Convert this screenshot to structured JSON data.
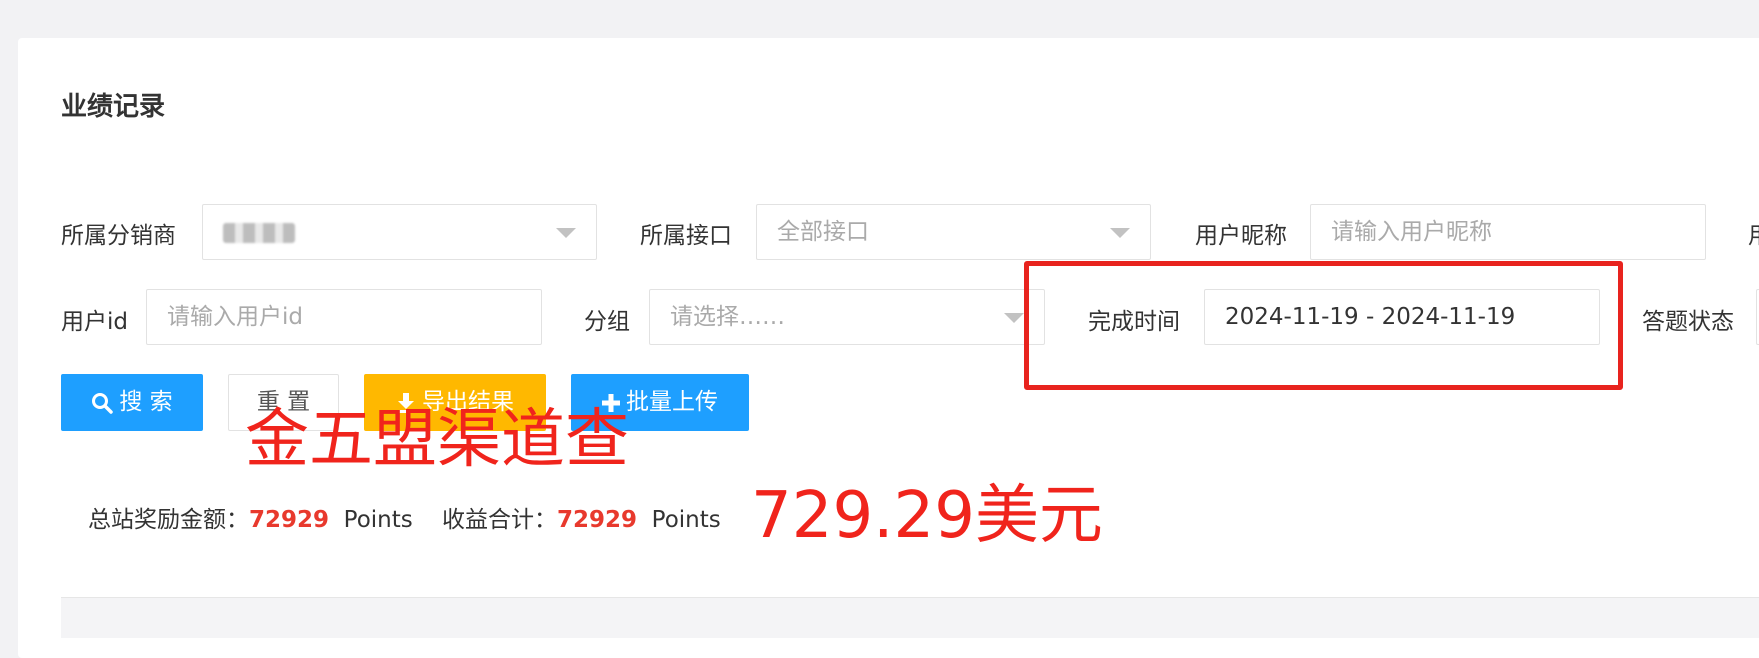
{
  "title": "业绩记录",
  "filters": {
    "distributor_label": "所属分销商",
    "interface_label": "所属接口",
    "interface_placeholder": "全部接口",
    "nickname_label": "用户昵称",
    "nickname_placeholder": "请输入用户昵称",
    "cutoff_label": "用",
    "userid_label": "用户id",
    "userid_placeholder": "请输入用户id",
    "group_label": "分组",
    "group_placeholder": "请选择……",
    "time_label": "完成时间",
    "time_value": "2024-11-19 - 2024-11-19",
    "answer_status_label": "答题状态"
  },
  "buttons": {
    "search": "搜 索",
    "reset": "重 置",
    "export": "导出结果",
    "upload": "批量上传"
  },
  "stats": {
    "total_label": "总站奖励金额：",
    "total_value": "72929",
    "total_unit": "Points",
    "income_label": "收益合计：",
    "income_value": "72929",
    "income_unit": "Points"
  },
  "annotations": {
    "channel_text": "金五盟渠道查",
    "usd_text": "729.29美元"
  },
  "colors": {
    "primary": "#1e9fff",
    "warning": "#ffb800",
    "highlight": "#e8392d",
    "annotation": "#f0241c"
  }
}
